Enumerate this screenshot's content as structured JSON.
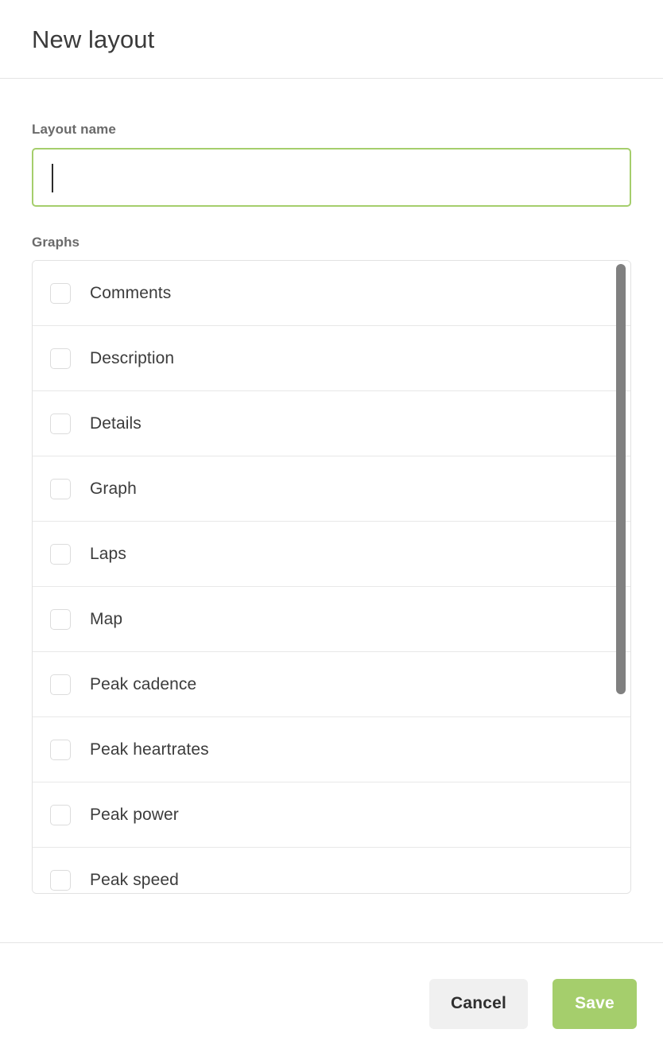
{
  "dialog": {
    "title": "New layout"
  },
  "form": {
    "name_label": "Layout name",
    "name_value": "",
    "name_placeholder": "",
    "graphs_label": "Graphs"
  },
  "graphs": {
    "items": [
      {
        "label": "Comments",
        "checked": false
      },
      {
        "label": "Description",
        "checked": false
      },
      {
        "label": "Details",
        "checked": false
      },
      {
        "label": "Graph",
        "checked": false
      },
      {
        "label": "Laps",
        "checked": false
      },
      {
        "label": "Map",
        "checked": false
      },
      {
        "label": "Peak cadence",
        "checked": false
      },
      {
        "label": "Peak heartrates",
        "checked": false
      },
      {
        "label": "Peak power",
        "checked": false
      },
      {
        "label": "Peak speed",
        "checked": false
      }
    ]
  },
  "footer": {
    "cancel_label": "Cancel",
    "save_label": "Save"
  },
  "colors": {
    "accent_green": "#a5ce6c",
    "cancel_bg": "#f0f0f0",
    "text_dark": "#3c3c3c",
    "label_gray": "#6a6a6a",
    "border_gray": "#e2e2e2",
    "scrollbar_thumb": "#808080"
  }
}
